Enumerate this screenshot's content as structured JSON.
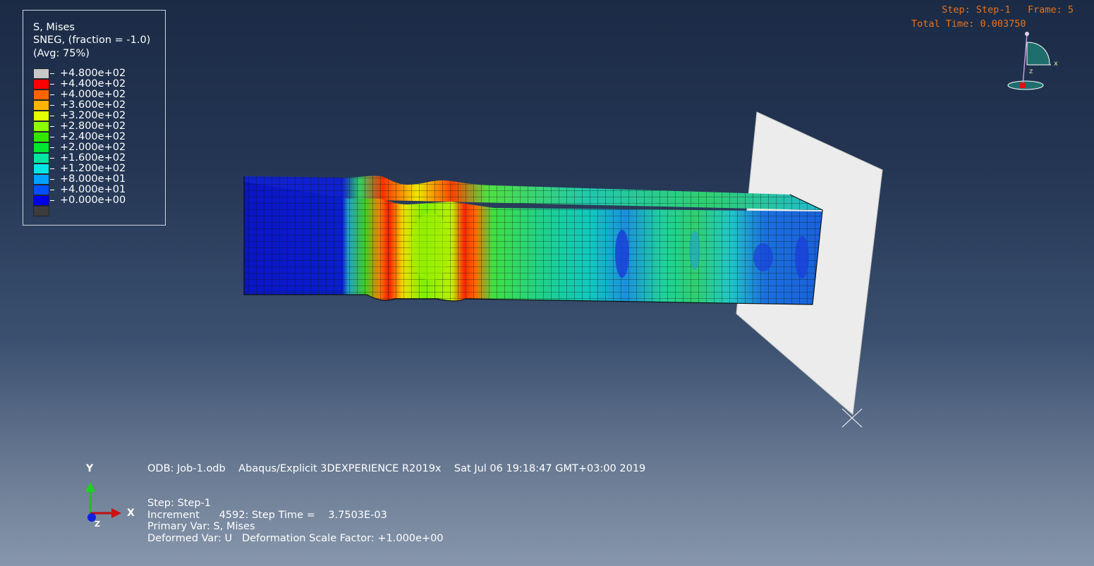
{
  "legend": {
    "title_line1": "S, Mises",
    "title_line2": "SNEG, (fraction = -1.0)",
    "title_line3": "(Avg: 75%)",
    "entries": [
      {
        "label": "+4.800e+02",
        "color": "#c8c8c8"
      },
      {
        "label": "+4.400e+02",
        "color": "#ff0000"
      },
      {
        "label": "+4.000e+02",
        "color": "#ff6400"
      },
      {
        "label": "+3.600e+02",
        "color": "#ffb400"
      },
      {
        "label": "+3.200e+02",
        "color": "#e6ff00"
      },
      {
        "label": "+2.800e+02",
        "color": "#8cff00"
      },
      {
        "label": "+2.400e+02",
        "color": "#32e600"
      },
      {
        "label": "+2.000e+02",
        "color": "#00e632"
      },
      {
        "label": "+1.600e+02",
        "color": "#00e6a0"
      },
      {
        "label": "+1.200e+02",
        "color": "#00e6e6"
      },
      {
        "label": "+8.000e+01",
        "color": "#00a0ff"
      },
      {
        "label": "+4.000e+01",
        "color": "#0050ff"
      },
      {
        "label": "+0.000e+00",
        "color": "#0000e6"
      },
      {
        "label": "",
        "color": "#3c3c3c"
      }
    ]
  },
  "status": {
    "step_line": "Step: Step-1   Frame: 5",
    "time_line": "Total Time: 0.003750"
  },
  "info": {
    "odb_line": "ODB: Job-1.odb    Abaqus/Explicit 3DEXPERIENCE R2019x    Sat Jul 06 19:18:47 GMT+03:00 2019",
    "step_line": "Step: Step-1",
    "increment_line": "Increment      4592: Step Time =    3.7503E-03",
    "primary_var_line": "Primary Var: S, Mises",
    "deformed_var_line": "Deformed Var: U   Deformation Scale Factor: +1.000e+00"
  },
  "triad": {
    "y_label": "Y",
    "x_label": "X",
    "z_label": "Z",
    "mini_x_label": "x",
    "mini_z_label": "z"
  },
  "colors": {
    "background_top": "#1b2b46",
    "background_bottom": "#8796ab",
    "status_text": "#e8731b",
    "rigid_plate": "#ececec"
  }
}
